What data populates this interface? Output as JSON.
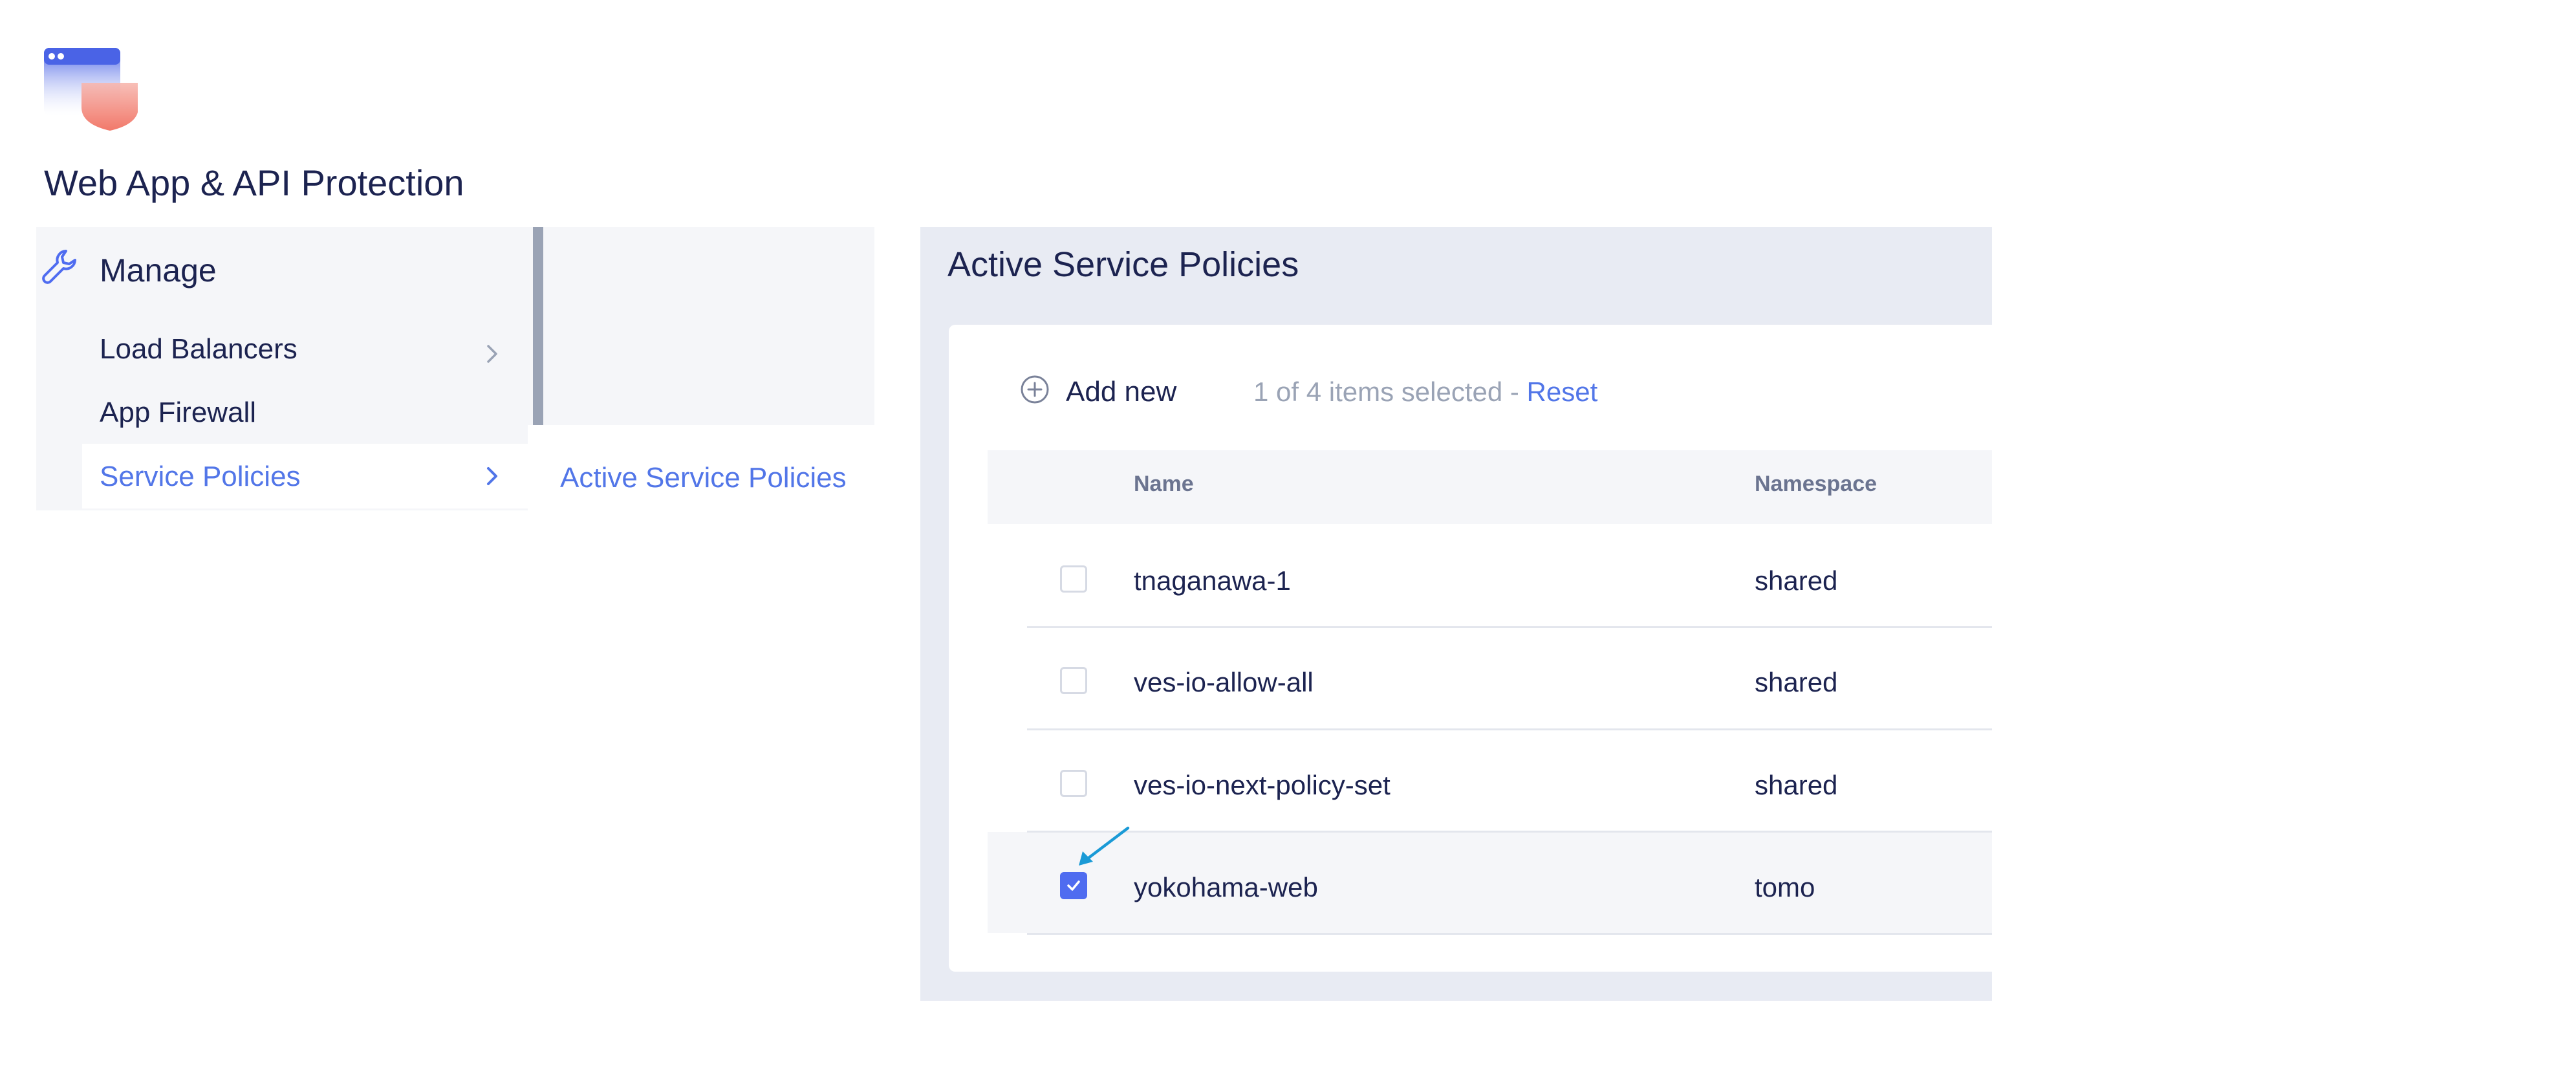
{
  "app": {
    "title": "Web App & API Protection"
  },
  "sidebar": {
    "section_label": "Manage",
    "items": [
      {
        "label": "Load Balancers",
        "has_submenu": true,
        "active": false
      },
      {
        "label": "App Firewall",
        "has_submenu": false,
        "active": false
      },
      {
        "label": "Service Policies",
        "has_submenu": true,
        "active": true
      }
    ],
    "submenu": {
      "items": [
        "Active Service Policies"
      ]
    }
  },
  "main": {
    "title": "Active Service Policies",
    "toolbar": {
      "add_label": "Add new",
      "selection_text": "1 of 4 items selected - ",
      "reset_label": "Reset"
    },
    "table": {
      "columns": [
        "Name",
        "Namespace"
      ],
      "rows": [
        {
          "name": "tnaganawa-1",
          "namespace": "shared",
          "checked": false
        },
        {
          "name": "ves-io-allow-all",
          "namespace": "shared",
          "checked": false
        },
        {
          "name": "ves-io-next-policy-set",
          "namespace": "shared",
          "checked": false
        },
        {
          "name": "yokohama-web",
          "namespace": "tomo",
          "checked": true
        }
      ]
    }
  },
  "colors": {
    "accent": "#5276e8",
    "checkbox_checked": "#4f6cf0",
    "text_primary": "#1c2350",
    "text_muted": "#9aa3b5",
    "panel_bg": "#e8ebf3",
    "nav_bg": "#f5f6f9",
    "annotation_arrow": "#1a9ad6"
  },
  "icons": {
    "app": "web-app-shield-icon",
    "manage": "wrench-icon",
    "add": "plus-circle-icon",
    "chevron": "chevron-right-icon",
    "check": "check-icon"
  }
}
